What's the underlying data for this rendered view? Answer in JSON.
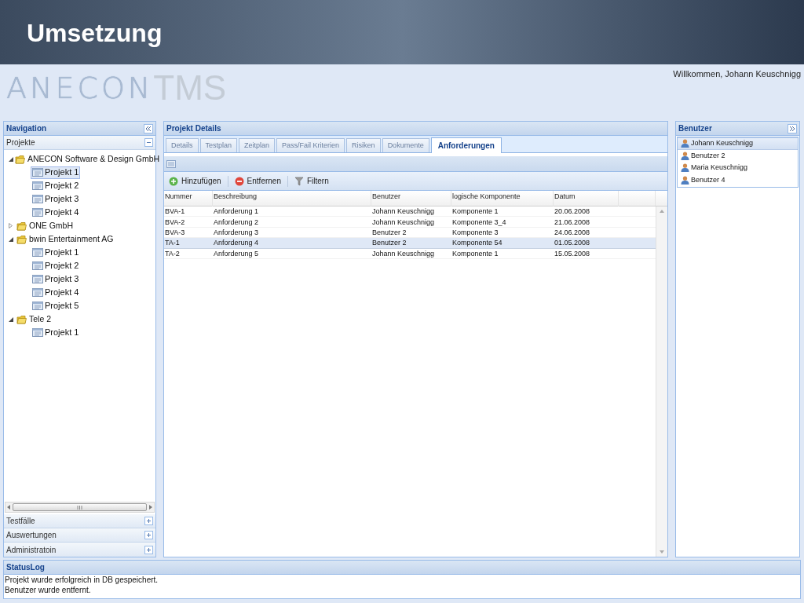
{
  "slide_title": "Umsetzung",
  "logo": {
    "brand": "ANECON",
    "product": "TMS"
  },
  "welcome": "Willkommen, Johann Keuschnigg",
  "navigation": {
    "title": "Navigation",
    "sections": [
      {
        "label": "Projekte",
        "expanded": true
      },
      {
        "label": "Testfälle",
        "expanded": false
      },
      {
        "label": "Auswertungen",
        "expanded": false
      },
      {
        "label": "Administratoin",
        "expanded": false
      }
    ],
    "tree": [
      {
        "label": "ANECON Software & Design GmbH",
        "expanded": true,
        "children": [
          {
            "label": "Projekt 1",
            "selected": true
          },
          {
            "label": "Projekt 2",
            "selected": false
          },
          {
            "label": "Projekt 3",
            "selected": false
          },
          {
            "label": "Projekt 4",
            "selected": false
          }
        ]
      },
      {
        "label": "ONE GmbH",
        "expanded": false
      },
      {
        "label": "bwin Entertainment AG",
        "expanded": true,
        "children": [
          {
            "label": "Projekt 1",
            "selected": false
          },
          {
            "label": "Projekt 2",
            "selected": false
          },
          {
            "label": "Projekt 3",
            "selected": false
          },
          {
            "label": "Projekt 4",
            "selected": false
          },
          {
            "label": "Projekt 5",
            "selected": false
          }
        ]
      },
      {
        "label": "Tele 2",
        "expanded": true,
        "children": [
          {
            "label": "Projekt 1",
            "selected": false
          }
        ]
      }
    ]
  },
  "details": {
    "title": "Projekt Details",
    "tabs": [
      {
        "label": "Details",
        "selected": false
      },
      {
        "label": "Testplan",
        "selected": false
      },
      {
        "label": "Zeitplan",
        "selected": false
      },
      {
        "label": "Pass/Fail Kriterien",
        "selected": false
      },
      {
        "label": "Risiken",
        "selected": false
      },
      {
        "label": "Dokumente",
        "selected": false
      },
      {
        "label": "Anforderungen",
        "selected": true
      }
    ],
    "toolbar": [
      {
        "kind": "add",
        "label": "Hinzufügen"
      },
      {
        "kind": "remove",
        "label": "Entfernen"
      },
      {
        "kind": "filter",
        "label": "Filtern"
      }
    ],
    "table": {
      "columns": [
        "Nummer",
        "Beschreibung",
        "Benutzer",
        "logische Komponente",
        "Datum"
      ],
      "rows": [
        {
          "cells": [
            "BVA-1",
            "Anforderung 1",
            "Johann Keuschnigg",
            "Komponente 1",
            "20.06.2008"
          ],
          "selected": false
        },
        {
          "cells": [
            "BVA-2",
            "Anforderung 2",
            "Johann Keuschnigg",
            "Komponente 3_4",
            "21.06.2008"
          ],
          "selected": false
        },
        {
          "cells": [
            "BVA-3",
            "Anforderung 3",
            "Benutzer 2",
            "Komponente 3",
            "24.06.2008"
          ],
          "selected": false
        },
        {
          "cells": [
            "TA-1",
            "Anforderung 4",
            "Benutzer 2",
            "Komponente 54",
            "01.05.2008"
          ],
          "selected": true
        },
        {
          "cells": [
            "TA-2",
            "Anforderung 5",
            "Johann Keuschnigg",
            "Komponente 1",
            "15.05.2008"
          ],
          "selected": false
        }
      ]
    }
  },
  "users": {
    "title": "Benutzer",
    "items": [
      {
        "label": "Johann Keuschnigg",
        "selected": true
      },
      {
        "label": "Benutzer 2",
        "selected": false
      },
      {
        "label": "Maria Keuschnigg",
        "selected": false
      },
      {
        "label": "Benutzer 4",
        "selected": false
      }
    ]
  },
  "status_log": {
    "title": "StatusLog",
    "lines": [
      "Projekt wurde erfolgreich in DB gespeichert.",
      "Benutzer wurde entfernt."
    ]
  }
}
